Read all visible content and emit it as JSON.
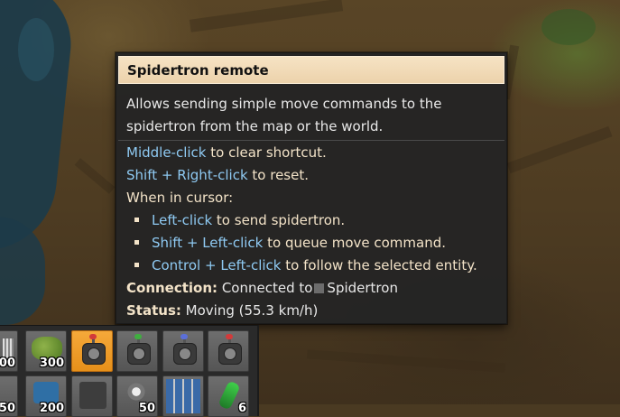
{
  "tooltip": {
    "title": "Spidertron remote",
    "description": "Allows sending simple move commands to the spidertron from the map or the world.",
    "lines": [
      {
        "key": "Middle-click",
        "text": " to clear shortcut."
      },
      {
        "key": "Shift + Right-click",
        "text": " to reset."
      },
      {
        "text": "When in cursor:"
      },
      {
        "key": "Left-click",
        "text": " to send spidertron."
      },
      {
        "key": "Shift + Left-click",
        "text": " to queue move command."
      },
      {
        "key": "Control + Left-click",
        "text": " to follow the selected entity."
      }
    ],
    "connection_label": "Connection:",
    "connection_text": "Connected to",
    "connection_target": "Spidertron",
    "status_label": "Status:",
    "status_value": "Moving (55.3 km/h)"
  },
  "quickbar": {
    "row1": [
      {
        "icon": "rail-icon",
        "count": "00"
      },
      {
        "icon": "tree-icon",
        "count": "300"
      },
      {
        "icon": "spidertron-remote-icon",
        "count": "",
        "active": true,
        "led": "#d23a3a"
      },
      {
        "icon": "spidertron-remote-icon",
        "count": "",
        "led": "#3fae3f"
      },
      {
        "icon": "spidertron-remote-icon",
        "count": "",
        "led": "#5b6fd8"
      },
      {
        "icon": "spidertron-remote-icon",
        "count": "",
        "led": "#d23a3a"
      }
    ],
    "row2": [
      {
        "icon": "item-icon",
        "count": "50"
      },
      {
        "icon": "item-icon",
        "count": "200"
      },
      {
        "icon": "machine-icon",
        "count": ""
      },
      {
        "icon": "gears-icon",
        "count": "50"
      },
      {
        "icon": "solar-panel-icon",
        "count": ""
      },
      {
        "icon": "capsule-icon",
        "count": "6"
      }
    ]
  },
  "colors": {
    "tooltip_title_bg": "#f0d8b2",
    "key_color": "#8fcaf3",
    "text_color": "#f3e3c8",
    "active_slot": "#f5a93a"
  }
}
